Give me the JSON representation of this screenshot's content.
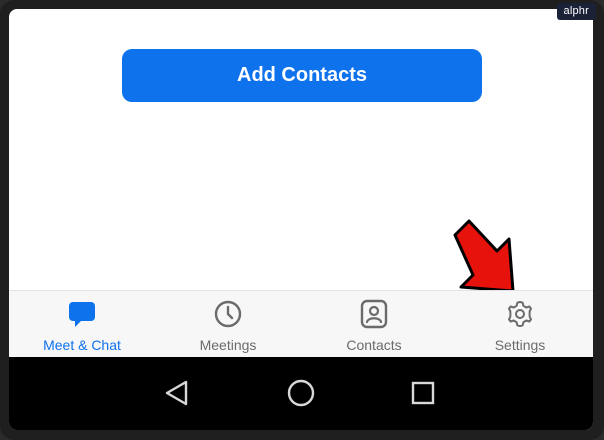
{
  "watermark": "alphr",
  "main": {
    "add_contacts_label": "Add Contacts"
  },
  "bottom_nav": {
    "items": [
      {
        "label": "Meet & Chat",
        "icon": "chat-bubble-icon",
        "active": true
      },
      {
        "label": "Meetings",
        "icon": "clock-icon",
        "active": false
      },
      {
        "label": "Contacts",
        "icon": "contact-card-icon",
        "active": false
      },
      {
        "label": "Settings",
        "icon": "gear-icon",
        "active": false
      }
    ]
  },
  "system_nav": {
    "buttons": [
      "back-icon",
      "home-icon",
      "recents-icon"
    ]
  },
  "colors": {
    "accent": "#0e72ed",
    "nav_text": "#6b6b6b",
    "arrow": "#e8120c",
    "system_bar": "#000000"
  }
}
